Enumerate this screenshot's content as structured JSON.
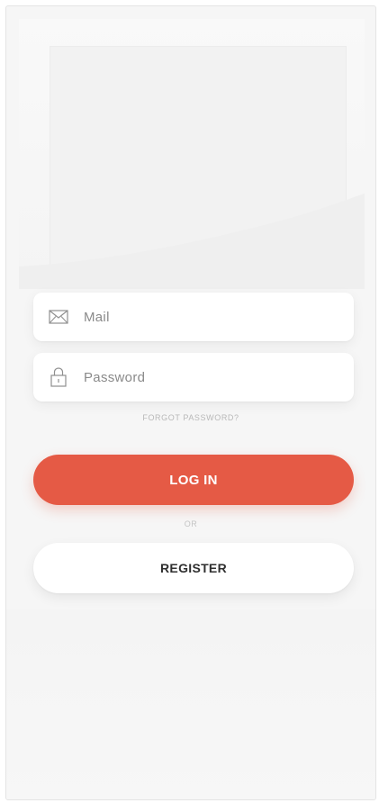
{
  "login_form": {
    "mail_placeholder": "Mail",
    "password_placeholder": "Password",
    "forgot_password": "FORGOT PASSWORD?",
    "login_label": "LOG IN",
    "or_label": "OR",
    "register_label": "REGISTER"
  },
  "icons": {
    "mail": "mail-icon",
    "password": "lock-icon"
  },
  "colors": {
    "accent": "#e55a45",
    "background": "#f6f6f6",
    "field": "#ffffff",
    "muted_text": "#8a8a8a"
  }
}
